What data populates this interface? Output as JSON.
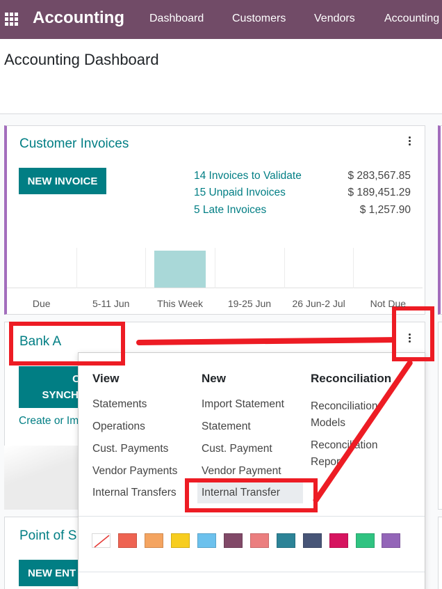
{
  "navbar": {
    "brand": "Accounting",
    "items": [
      "Dashboard",
      "Customers",
      "Vendors",
      "Accounting"
    ]
  },
  "page": {
    "title": "Accounting Dashboard"
  },
  "customer_invoices": {
    "title": "Customer Invoices",
    "new_button": "NEW INVOICE",
    "stats": [
      {
        "label": "14 Invoices to Validate",
        "amount": "$ 283,567.85"
      },
      {
        "label": "15 Unpaid Invoices",
        "amount": "$ 189,451.29"
      },
      {
        "label": "5 Late Invoices",
        "amount": "$ 1,257.90"
      }
    ],
    "chart_data": {
      "type": "bar",
      "categories": [
        "Due",
        "5-11 Jun",
        "This Week",
        "19-25 Jun",
        "26 Jun-2 Jul",
        "Not Due"
      ],
      "values": [
        0,
        0,
        1,
        0,
        0,
        0
      ],
      "title": "",
      "xlabel": "",
      "ylabel": ""
    }
  },
  "bank": {
    "title": "Bank A",
    "sync_button": "SYNCH",
    "sync_button_top": "C",
    "create_link": "Create or Im"
  },
  "pos": {
    "title": "Point of S",
    "new_button": "NEW ENT"
  },
  "dropdown": {
    "columns": [
      {
        "header": "View",
        "items": [
          "Statements",
          "Operations",
          "Cust. Payments",
          "Vendor Payments",
          "Internal Transfers"
        ]
      },
      {
        "header": "New",
        "items": [
          "Import Statement",
          "Statement",
          "Cust. Payment",
          "Vendor Payment",
          "Internal Transfer"
        ]
      },
      {
        "header": "Reconciliation",
        "items": [
          "Reconciliation\nModels",
          "Reconciliation\nReport"
        ]
      }
    ],
    "colors": [
      "#ffffff",
      "#ee6352",
      "#f4a460",
      "#f7cd1f",
      "#6cc1ed",
      "#814968",
      "#eb7e7f",
      "#2c8397",
      "#475577",
      "#d6145f",
      "#30c381",
      "#9365b8"
    ]
  },
  "annotation": {
    "color": "#ed1c24"
  }
}
